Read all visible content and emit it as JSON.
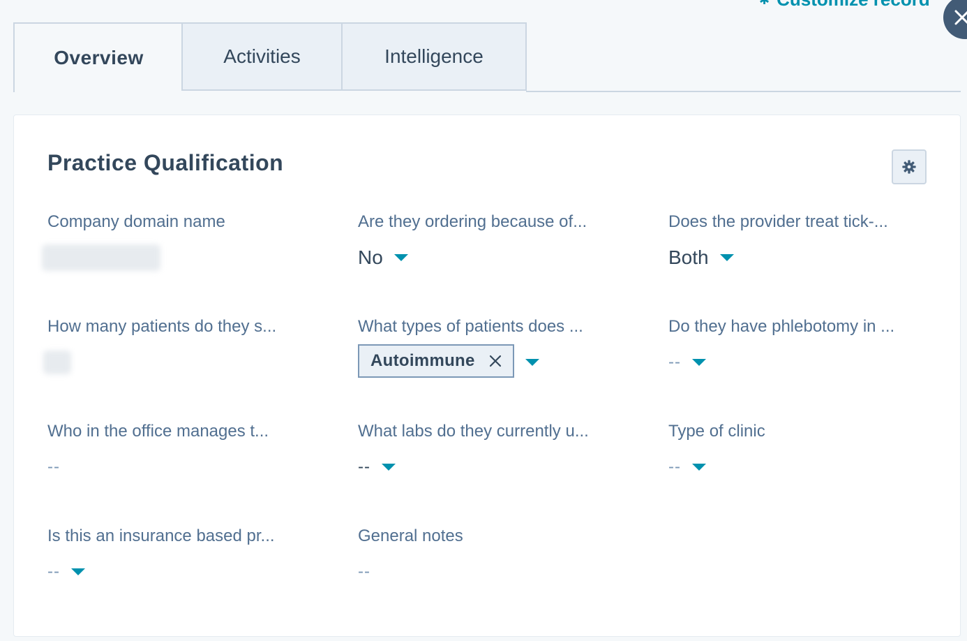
{
  "header": {
    "customize_label": "Customize record",
    "colors": {
      "accent": "#0091ae",
      "close_bg": "#425b76"
    }
  },
  "tabs": [
    {
      "label": "Overview",
      "active": true
    },
    {
      "label": "Activities",
      "active": false
    },
    {
      "label": "Intelligence",
      "active": false
    }
  ],
  "card": {
    "title": "Practice Qualification",
    "settings_icon": "gear-icon",
    "fields": [
      {
        "label": "Company domain name",
        "value": "",
        "redacted": true,
        "dropdown": false
      },
      {
        "label": "Are they ordering because of...",
        "value": "No",
        "dropdown": true
      },
      {
        "label": "Does the provider treat tick-...",
        "value": "Both",
        "dropdown": true
      },
      {
        "label": "How many patients do they s...",
        "value": "",
        "redacted": true,
        "dropdown": false
      },
      {
        "label": "What types of patients does ...",
        "tag": "Autoimmune",
        "dropdown": true
      },
      {
        "label": "Do they have phlebotomy in ...",
        "value": "--",
        "dropdown": true
      },
      {
        "label": "Who in the office manages t...",
        "value": "--",
        "dropdown": false
      },
      {
        "label": "What labs do they currently u...",
        "value": "--",
        "dropdown": true
      },
      {
        "label": "Type of clinic",
        "value": "--",
        "dropdown": true
      },
      {
        "label": "Is this an insurance based pr...",
        "value": "--",
        "dropdown": true
      },
      {
        "label": "General notes",
        "value": "--",
        "dropdown": false
      }
    ]
  }
}
